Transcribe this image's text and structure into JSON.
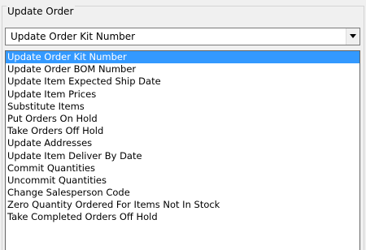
{
  "group": {
    "title": "Update Order"
  },
  "combo": {
    "selected": "Update Order Kit Number",
    "dropdown_icon": "chevron-down-icon"
  },
  "dropdown": {
    "highlighted_index": 0,
    "options": [
      "Update Order Kit Number",
      "Update Order BOM Number",
      "Update Item Expected Ship Date",
      "Update Item Prices",
      "Substitute Items",
      "Put Orders On Hold",
      "Take Orders Off Hold",
      "Update Addresses",
      "Update Item Deliver By Date",
      "Commit Quantities",
      "Uncommit Quantities",
      "Change Salesperson Code",
      "Zero Quantity Ordered For Items Not In Stock",
      "Take Completed Orders Off Hold"
    ]
  },
  "colors": {
    "highlight": "#3399ff",
    "background": "#f0f0f0"
  }
}
